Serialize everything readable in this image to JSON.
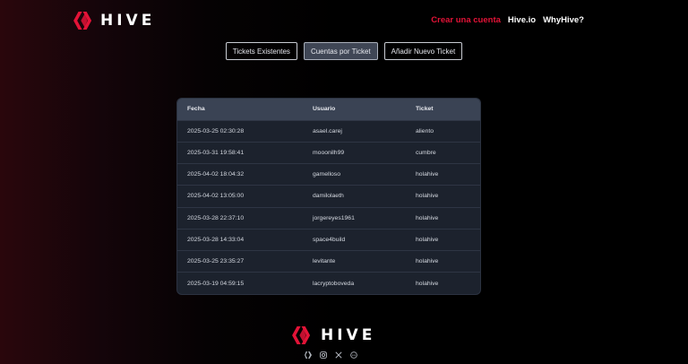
{
  "brand": {
    "name": "HIVE",
    "icon": "hive-logo-icon",
    "accent": "#e31337"
  },
  "nav": [
    {
      "label": "Crear una cuenta",
      "accent": true
    },
    {
      "label": "Hive.io",
      "accent": false
    },
    {
      "label": "WhyHive?",
      "accent": false
    }
  ],
  "tabs": [
    {
      "label": "Tickets Existentes",
      "active": false
    },
    {
      "label": "Cuentas por Ticket",
      "active": true
    },
    {
      "label": "Añadir Nuevo Ticket",
      "active": false
    }
  ],
  "table": {
    "columns": [
      "Fecha",
      "Usuario",
      "Ticket"
    ],
    "rows": [
      [
        "2025-03-25 02:30:28",
        "asael.carej",
        "aliento"
      ],
      [
        "2025-03-31 19:58:41",
        "mooonilh99",
        "cumbre"
      ],
      [
        "2025-04-02 18:04:32",
        "gamelloso",
        "holahive"
      ],
      [
        "2025-04-02 13:05:00",
        "damilolaeth",
        "holahive"
      ],
      [
        "2025-03-28 22:37:10",
        "jorgereyes1961",
        "holahive"
      ],
      [
        "2025-03-28 14:33:04",
        "space4build",
        "holahive"
      ],
      [
        "2025-03-25 23:35:27",
        "levitante",
        "holahive"
      ],
      [
        "2025-03-19 04:59:15",
        "lacryptoboveda",
        "holahive"
      ]
    ]
  },
  "footer": {
    "brand": "HIVE",
    "social": [
      "hive-icon",
      "instagram-icon",
      "x-icon",
      "discord-icon"
    ]
  }
}
